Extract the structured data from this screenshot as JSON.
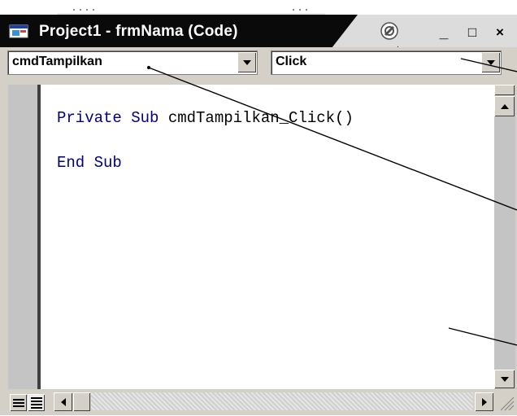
{
  "window": {
    "title": "Project1 - frmNama (Code)",
    "controls": {
      "minimize": "_",
      "maximize": "□",
      "close": "×"
    }
  },
  "object_combo": {
    "value": "cmdTampilkan"
  },
  "procedure_combo": {
    "value": "Click"
  },
  "code": {
    "line1_keyword": "Private Sub",
    "line1_name": "cmdTampilkan_Click()",
    "line2_keyword": "End Sub"
  },
  "icons": {
    "app": "vb-form-icon",
    "settings": "settings-badge-icon",
    "procedure_view": "procedure-view-icon",
    "full_module_view": "full-module-view-icon"
  },
  "colors": {
    "keyword": "#00007f",
    "titlebar": "#0a0a0a",
    "chrome": "#d4d0c8"
  }
}
